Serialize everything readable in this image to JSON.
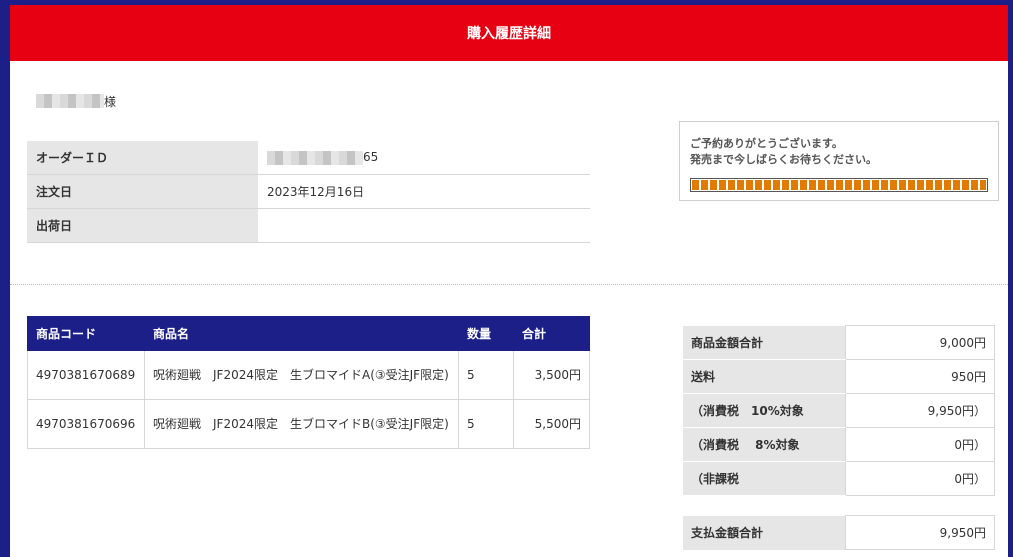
{
  "header": {
    "title": "購入履歴詳細"
  },
  "customer": {
    "suffix": "様"
  },
  "order_info": {
    "rows": [
      {
        "label": "オーダーＩＤ",
        "value": "65"
      },
      {
        "label": "注文日",
        "value": "2023年12月16日"
      },
      {
        "label": "出荷日",
        "value": ""
      }
    ]
  },
  "reservation": {
    "line1": "ご予約ありがとうございます。",
    "line2": "発売まで今しばらくお待ちください。",
    "progress": 1.0,
    "progress_color": "#e07b00"
  },
  "items": {
    "headers": [
      "商品コード",
      "商品名",
      "数量",
      "合計"
    ],
    "rows": [
      [
        "4970381670689",
        "呪術廻戦　JF2024限定　生ブロマイドA(③受注JF限定)",
        "5",
        "3,500円"
      ],
      [
        "4970381670696",
        "呪術廻戦　JF2024限定　生ブロマイドB(③受注JF限定)",
        "5",
        "5,500円"
      ]
    ]
  },
  "summary": {
    "rows": [
      {
        "label": "商品金額合計",
        "value": "9,000円"
      },
      {
        "label": "送料",
        "value": "950円"
      },
      {
        "label": "（消費税　10%対象",
        "value": "9,950円）"
      },
      {
        "label": "（消費税　 8%対象",
        "value": "0円）"
      },
      {
        "label": "（非課税",
        "value": "0円）"
      }
    ]
  },
  "total": {
    "label": "支払金額合計",
    "value": "9,950円"
  },
  "colors": {
    "header_red": "#e60012",
    "navy": "#1b1f87",
    "label_gray": "#e6e6e6"
  }
}
